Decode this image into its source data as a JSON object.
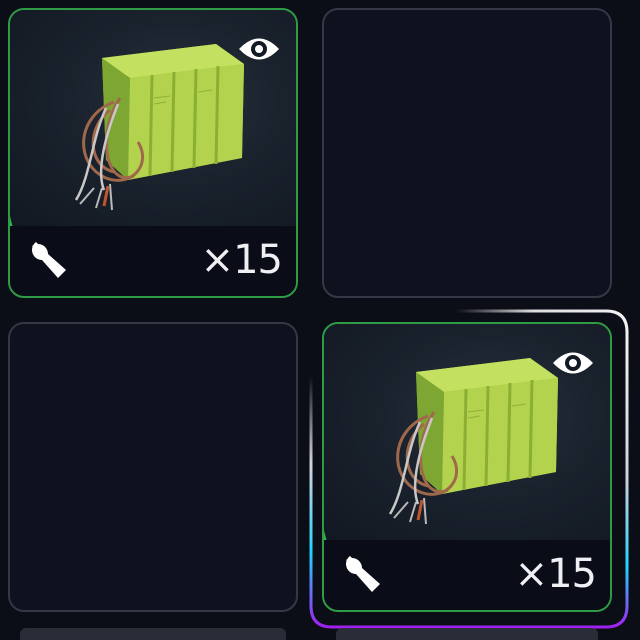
{
  "inventory": {
    "slots": [
      {
        "state": "filled",
        "item_icon": "battery-pack-icon",
        "view_icon": "eye-icon",
        "type_icon": "wrench-icon",
        "count": "×15",
        "rarity_color": "#2cb84b"
      },
      {
        "state": "empty"
      },
      {
        "state": "empty"
      },
      {
        "state": "filled",
        "selected": true,
        "item_icon": "battery-pack-icon",
        "view_icon": "eye-icon",
        "type_icon": "wrench-icon",
        "count": "×15",
        "rarity_color": "#2cb84b"
      }
    ]
  },
  "colors": {
    "background": "#0b0d17",
    "slot_border": "#343846",
    "rarity_green": "#2cb84b",
    "selection_glow_white": "#f2f2f2",
    "selection_glow_cyan": "#1fd3ff",
    "selection_glow_purple": "#a020f0"
  }
}
